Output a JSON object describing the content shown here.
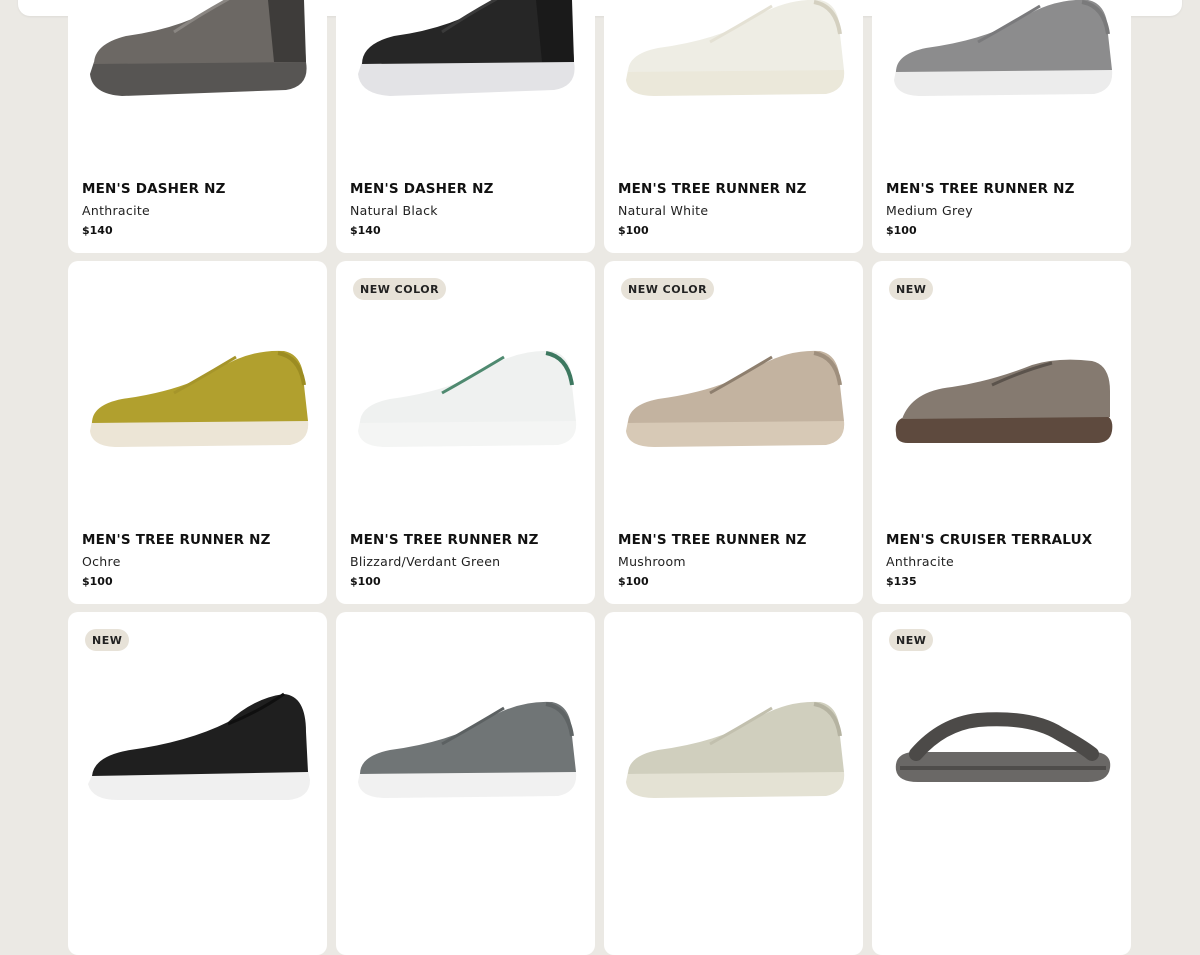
{
  "products": [
    {
      "name": "MEN'S DASHER NZ",
      "color": "Anthracite",
      "price": "$140",
      "badge": "",
      "shoe": {
        "style": "dasher",
        "upper": "#6c6864",
        "upper_dark": "#4d4a47",
        "sole": "#575553",
        "accent": "#3e3c3a",
        "laces": "#8a8682"
      }
    },
    {
      "name": "MEN'S DASHER NZ",
      "color": "Natural Black",
      "price": "$140",
      "badge": "",
      "shoe": {
        "style": "dasher",
        "upper": "#262626",
        "upper_dark": "#141414",
        "sole": "#e3e3e6",
        "accent": "#1a1a1a",
        "laces": "#3a3a3a"
      }
    },
    {
      "name": "MEN'S TREE RUNNER NZ",
      "color": "Natural White",
      "price": "$100",
      "badge": "",
      "shoe": {
        "style": "runner",
        "upper": "#eeede4",
        "upper_dark": "#d9d6c9",
        "sole": "#ebe8da",
        "accent": "#d4d0c0",
        "laces": "#e4e1d4"
      }
    },
    {
      "name": "MEN'S TREE RUNNER NZ",
      "color": "Medium Grey",
      "price": "$100",
      "badge": "",
      "shoe": {
        "style": "runner",
        "upper": "#8c8c8d",
        "upper_dark": "#6f6f70",
        "sole": "#ececec",
        "accent": "#7a7a7b",
        "laces": "#7a7a7c"
      }
    },
    {
      "name": "MEN'S TREE RUNNER NZ",
      "color": "Ochre",
      "price": "$100",
      "badge": "",
      "shoe": {
        "style": "runner",
        "upper": "#b1a02e",
        "upper_dark": "#8f7f1e",
        "sole": "#ece5d6",
        "accent": "#9c8c22",
        "laces": "#a6952a"
      }
    },
    {
      "name": "MEN'S TREE RUNNER NZ",
      "color": "Blizzard/Verdant Green",
      "price": "$100",
      "badge": "NEW COLOR",
      "shoe": {
        "style": "runner",
        "upper": "#eff1f0",
        "upper_dark": "#d8dcda",
        "sole": "#f4f5f4",
        "accent": "#3d7860",
        "laces": "#4f8a70"
      }
    },
    {
      "name": "MEN'S TREE RUNNER NZ",
      "color": "Mushroom",
      "price": "$100",
      "badge": "NEW COLOR",
      "shoe": {
        "style": "runner",
        "upper": "#c3b3a0",
        "upper_dark": "#a69583",
        "sole": "#d7c9b6",
        "accent": "#9f8f7d",
        "laces": "#8e7f6e"
      }
    },
    {
      "name": "MEN'S CRUISER TERRALUX",
      "color": "Anthracite",
      "price": "$135",
      "badge": "NEW",
      "shoe": {
        "style": "cruiser",
        "upper": "#857a70",
        "upper_dark": "#6c6259",
        "sole": "#5e4a3e",
        "accent": "#6f645b",
        "laces": "#5b534c"
      }
    },
    {
      "name": "",
      "color": "",
      "price": "",
      "badge": "NEW",
      "shoe": {
        "style": "slipon",
        "upper": "#1f1f1f",
        "upper_dark": "#0f0f0f",
        "sole": "#f0f0f0",
        "accent": "#2c2c2c",
        "laces": "#1f1f1f"
      }
    },
    {
      "name": "",
      "color": "",
      "price": "",
      "badge": "",
      "shoe": {
        "style": "runner",
        "upper": "#707576",
        "upper_dark": "#575c5d",
        "sole": "#f1f1f1",
        "accent": "#5f6465",
        "laces": "#5c6162"
      }
    },
    {
      "name": "",
      "color": "",
      "price": "",
      "badge": "",
      "shoe": {
        "style": "runner",
        "upper": "#d0cfbe",
        "upper_dark": "#b8b6a4",
        "sole": "#e4e2d4",
        "accent": "#b5b3a1",
        "laces": "#c2c0ae"
      }
    },
    {
      "name": "",
      "color": "",
      "price": "",
      "badge": "NEW",
      "shoe": {
        "style": "flipflop",
        "upper": "#6a6866",
        "upper_dark": "#4f4d4b",
        "sole": "#6a6866",
        "accent": "#4c4a48",
        "laces": "#6a6866"
      }
    }
  ]
}
